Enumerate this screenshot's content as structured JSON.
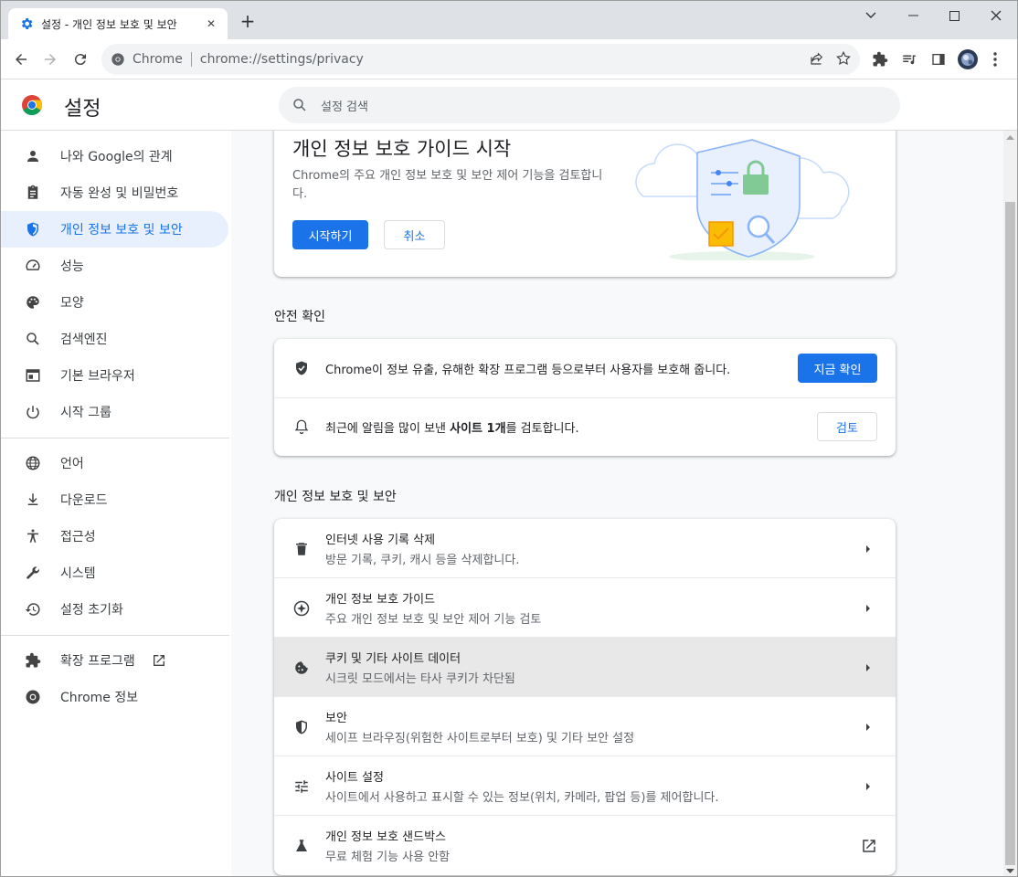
{
  "browser": {
    "tab_title": "설정 - 개인 정보 보호 및 보안",
    "tab_close": "✕",
    "new_tab": "+",
    "site_chip": "Chrome",
    "url": "chrome://settings/privacy"
  },
  "header": {
    "title": "설정",
    "search_placeholder": "설정 검색"
  },
  "sidebar": {
    "items": [
      {
        "label": "나와 Google의 관계",
        "icon": "person-icon"
      },
      {
        "label": "자동 완성 및 비밀번호",
        "icon": "clipboard-icon"
      },
      {
        "label": "개인 정보 보호 및 보안",
        "icon": "shield-icon",
        "selected": true
      },
      {
        "label": "성능",
        "icon": "speedometer-icon"
      },
      {
        "label": "모양",
        "icon": "palette-icon"
      },
      {
        "label": "검색엔진",
        "icon": "search-icon"
      },
      {
        "label": "기본 브라우저",
        "icon": "browser-icon"
      },
      {
        "label": "시작 그룹",
        "icon": "power-icon"
      },
      {
        "label": "언어",
        "icon": "globe-icon"
      },
      {
        "label": "다운로드",
        "icon": "download-icon"
      },
      {
        "label": "접근성",
        "icon": "accessibility-icon"
      },
      {
        "label": "시스템",
        "icon": "wrench-icon"
      },
      {
        "label": "설정 초기화",
        "icon": "history-icon"
      },
      {
        "label": "확장 프로그램",
        "icon": "puzzle-icon"
      },
      {
        "label": "Chrome 정보",
        "icon": "chrome-icon"
      }
    ]
  },
  "guide_card": {
    "title": "개인 정보 보호 가이드 시작",
    "description": "Chrome의 주요 개인 정보 보호 및 보안 제어 기능을 검토합니다.",
    "start_button": "시작하기",
    "cancel_button": "취소"
  },
  "safety_check": {
    "section_title": "안전 확인",
    "row1_text": "Chrome이 정보 유출, 유해한 확장 프로그램 등으로부터 사용자를 보호해 줍니다.",
    "row1_button": "지금 확인",
    "row2_prefix": "최근에 알림을 많이 보낸 ",
    "row2_bold": "사이트 1개",
    "row2_suffix": "를 검토합니다.",
    "row2_button": "검토"
  },
  "privacy": {
    "section_title": "개인 정보 보호 및 보안",
    "rows": [
      {
        "title": "인터넷 사용 기록 삭제",
        "subtitle": "방문 기록, 쿠키, 캐시 등을 삭제합니다.",
        "icon": "trash-icon"
      },
      {
        "title": "개인 정보 보호 가이드",
        "subtitle": "주요 개인 정보 보호 및 보안 제어 기능 검토",
        "icon": "compass-icon"
      },
      {
        "title": "쿠키 및 기타 사이트 데이터",
        "subtitle": "시크릿 모드에서는 타사 쿠키가 차단됨",
        "icon": "cookie-icon"
      },
      {
        "title": "보안",
        "subtitle": "세이프 브라우징(위험한 사이트로부터 보호) 및 기타 보안 설정",
        "icon": "security-shield-icon"
      },
      {
        "title": "사이트 설정",
        "subtitle": "사이트에서 사용하고 표시할 수 있는 정보(위치, 카메라, 팝업 등)를 제어합니다.",
        "icon": "tune-icon"
      },
      {
        "title": "개인 정보 보호 샌드박스",
        "subtitle": "무료 체험 기능 사용 안함",
        "icon": "flask-icon"
      }
    ]
  },
  "colors": {
    "accent": "#1a73e8",
    "selected_bg": "#e8f0fe",
    "hover_row": "#e8e8e8"
  }
}
